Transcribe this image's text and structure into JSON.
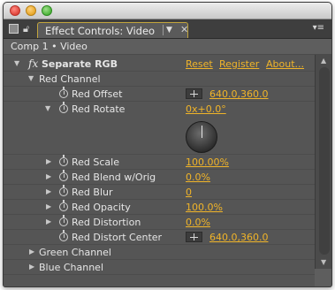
{
  "window": {
    "title": "Effect Controls: Video"
  },
  "comp": {
    "label": "Comp 1 • Video"
  },
  "effect": {
    "name": "Separate RGB",
    "fx_label": "fx",
    "links": {
      "reset": "Reset",
      "register": "Register",
      "about": "About..."
    }
  },
  "red_channel": {
    "label": "Red Channel"
  },
  "properties": {
    "red_offset": {
      "label": "Red Offset",
      "value": "640.0,360.0"
    },
    "red_rotate": {
      "label": "Red Rotate",
      "value": "0x+0.0°"
    },
    "red_scale": {
      "label": "Red Scale",
      "value": "100.00%"
    },
    "red_blend": {
      "label": "Red Blend w/Orig",
      "value": "0.0%"
    },
    "red_blur": {
      "label": "Red Blur",
      "value": "0"
    },
    "red_opacity": {
      "label": "Red Opacity",
      "value": "100.0%"
    },
    "red_distortion": {
      "label": "Red Distortion",
      "value": "0.0%"
    },
    "red_distort_center": {
      "label": "Red Distort Center",
      "value": "640.0,360.0"
    }
  },
  "green_channel": {
    "label": "Green Channel"
  },
  "blue_channel": {
    "label": "Blue Channel"
  },
  "icons": {
    "close": "window-close-icon",
    "minimize": "window-minimize-icon",
    "zoom": "window-zoom-icon",
    "panel": "panel-icon",
    "lock": "lock-icon",
    "stopwatch": "stopwatch-icon",
    "crosshair": "crosshair-icon",
    "twirl_open": "twirl-down-icon",
    "twirl_closed": "twirl-right-icon",
    "menu": "panel-menu-icon"
  },
  "colors": {
    "accent": "#f0b429",
    "panel_bg": "#555555",
    "tab_outline": "#c2a53c"
  }
}
